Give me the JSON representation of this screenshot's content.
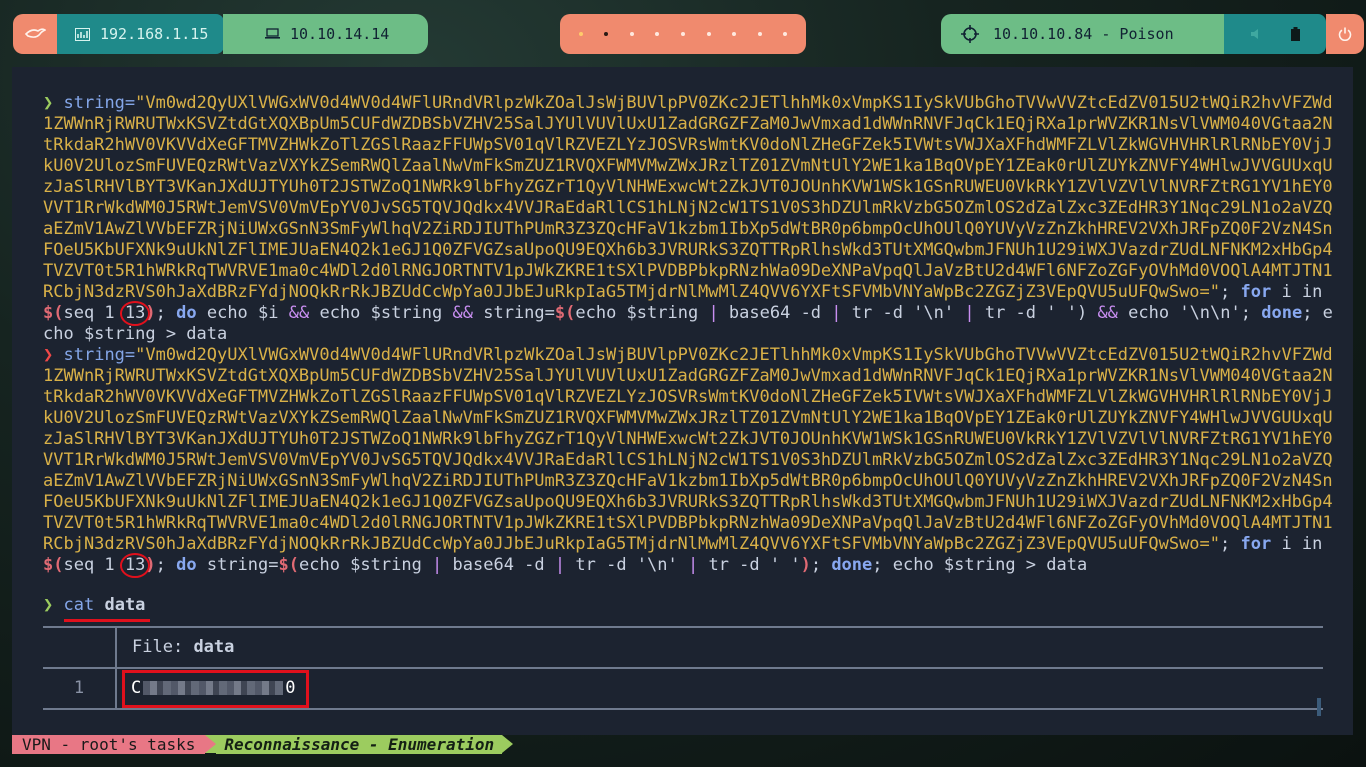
{
  "topbar": {
    "local_ip": "192.168.1.15",
    "vpn_ip": "10.10.14.14",
    "target": "10.10.10.84 - Poison",
    "workspaces": 9
  },
  "terminal": {
    "cmd1": {
      "prompt": "❯",
      "var": "string=",
      "payload": "\"Vm0wd2QyUXlVWGxWV0d4WV0d4WFlURndVRlpzWkZOalJsWjBUVlpPV0ZKc2JETlhhMk0xVmpKS1IySkVUbGhoTVVwVVZtcEdZV015U2tWQiR2hvVFZWd1ZWWnRjRWRUTWxKSVZtdGtXQXBpUm5CUFdWZDBSbVZHV25SalJYUlVUVlUxU1ZadGRGZFZaM0JwVmxad1dWWnRNVFJqCk1EQjRXa1prWVZKR1NsVlVWM040VGtaa2NtRkdaR2hWV0VKVVdXeGFTMVZHWkZoTlZGSlRaazFFUWpSV01qVlRZVEZLYzJOSVRsWmtKV0doNlZHeGFZek5IVWtsVWJXaXFhdWMFZLVlZkWGVHVHRlRlRNbEY0VjJkU0V2UlozSmFUVEQzRWtVazVXYkZSemRWQlZaalNwVmFkSmZUZ1RVQXFWMVMwZWxJRzlTZ01ZVmNtUlY2WE1ka1BqOVpEY1ZEak0rUlZUYkZNVFY4WHlwJVVGUUxqUzJaSlRHVlBYT3VKanJXdUJTYUh0T2JSTWZoQ1NWRk9lbFhyZGZrT1QyVlNHWExwcWt2ZkJVT0JOUnhKVW1WSk1GSnRUWEU0VkRkY1ZVlVZVlVlNVRFZtRG1YV1hEY0VVT1RrWkdWM0J5RWtJemVSV0VmVEpYV0JvSG5TQVJQdkx4VVJRaEdaRllCS1hLNjN2cW1TS1V0S3hDZUlmRkVzbG5OZmlOS2dZalZxc3ZEdHR3Y1Nqc29LN1o2aVZQaEZmV1AwZlVVbEFZRjNiUWxGSnN3SmFyWlhqV2ZiRDJIUThPUmR3Z3ZQcHFaV1kzbm1IbXp5dWtBR0p6bmpOcUhOUlQ0YUVyVzZnZkhHREV2VXhJRFpZQ0F2VzN4SnFOeU5KbUFXNk9uUkNlZFlIMEJUaEN4Q2k1eGJ1Q0ZFVGZsaUpoQU9EQXh6b3JVRURkS3ZQTTRpRlhsWkd3TUtXMGQwbmJFNUh1U29iWXJVazdrZUdLNFNKM2xHbGp4TVZVT0t5R1hWRkRqTWVRVE1ma0c4WDl2d0lRNGJORTNTV1pJWkZKRE1tSXlPVDBPbkpRNzhWa09DeXNPaVpqQlJaVzBtU2d4WFl6NFZoZGFyOVhMd0VOQlA4MTJTN1RCbjN3dzRVS0hJaXdBRzFYdjNOQkRrRkJBZUdCcWpYa0JJbEJuRkpIaG5TMjdrNlMwMlZ4QVV6YXFtSFVMbVNYaWpBc2ZGZjZ3VEpQVU5uUFQwSwo=\"",
      "rest": [
        {
          "t": "; ",
          "c": ""
        },
        {
          "t": "for",
          "c": "kw"
        },
        {
          "t": " i in ",
          "c": ""
        },
        {
          "t": "$(",
          "c": "sub"
        },
        {
          "t": "seq 1 ",
          "c": ""
        },
        {
          "t": "13",
          "c": "circ"
        },
        {
          "t": ")",
          "c": "sub"
        },
        {
          "t": "; ",
          "c": ""
        },
        {
          "t": "do",
          "c": "kw"
        },
        {
          "t": " echo $i ",
          "c": ""
        },
        {
          "t": "&&",
          "c": "pipe"
        },
        {
          "t": " echo $string ",
          "c": ""
        },
        {
          "t": "&&",
          "c": "pipe"
        },
        {
          "t": " string=",
          "c": ""
        },
        {
          "t": "$(",
          "c": "sub"
        },
        {
          "t": "echo $string ",
          "c": ""
        },
        {
          "t": "|",
          "c": "pipe"
        },
        {
          "t": " base64 -d ",
          "c": ""
        },
        {
          "t": "|",
          "c": "pipe"
        },
        {
          "t": " tr -d '\\n' ",
          "c": ""
        },
        {
          "t": "|",
          "c": "pipe"
        },
        {
          "t": " tr -d ' ')",
          "c": ""
        },
        {
          "t": " && ",
          "c": "pipe"
        },
        {
          "t": "echo '\\n\\n'",
          "c": ""
        },
        {
          "t": "; ",
          "c": ""
        },
        {
          "t": "done",
          "c": "kw"
        },
        {
          "t": "; echo $string > data",
          "c": ""
        }
      ]
    },
    "cmd2": {
      "prompt": "❯",
      "var": "string=",
      "rest": [
        {
          "t": "; ",
          "c": ""
        },
        {
          "t": "for",
          "c": "kw"
        },
        {
          "t": " i in ",
          "c": ""
        },
        {
          "t": "$(",
          "c": "sub"
        },
        {
          "t": "seq 1 ",
          "c": ""
        },
        {
          "t": "13",
          "c": "circ"
        },
        {
          "t": ")",
          "c": "sub"
        },
        {
          "t": "; ",
          "c": ""
        },
        {
          "t": "do",
          "c": "kw"
        },
        {
          "t": " string=",
          "c": ""
        },
        {
          "t": "$(",
          "c": "sub"
        },
        {
          "t": "echo $string ",
          "c": ""
        },
        {
          "t": "|",
          "c": "pipe"
        },
        {
          "t": " base64 -d ",
          "c": ""
        },
        {
          "t": "|",
          "c": "pipe"
        },
        {
          "t": " tr -d '\\n' ",
          "c": ""
        },
        {
          "t": "|",
          "c": "pipe"
        },
        {
          "t": " tr -d ' '",
          "c": ""
        },
        {
          "t": ")",
          "c": "sub"
        },
        {
          "t": "; ",
          "c": ""
        },
        {
          "t": "done",
          "c": "kw"
        },
        {
          "t": "; echo $string > data",
          "c": ""
        }
      ]
    },
    "cat": {
      "prompt": "❯",
      "cmd": "cat",
      "arg": "data"
    },
    "bat": {
      "header_label": "File:",
      "header_file": "data",
      "line_no": "1",
      "first_char": "C",
      "last_char": "0"
    }
  },
  "statusbar": {
    "session": "VPN - root's tasks",
    "window": "Reconnaissance - Enumeration"
  },
  "colors": {
    "accent_orange": "#f08a6e",
    "accent_green": "#6dbd86",
    "accent_teal": "#1f8a8a",
    "terminal_bg": "#1c2330",
    "string_yellow": "#d9b148",
    "highlight_red": "#e0101c"
  }
}
